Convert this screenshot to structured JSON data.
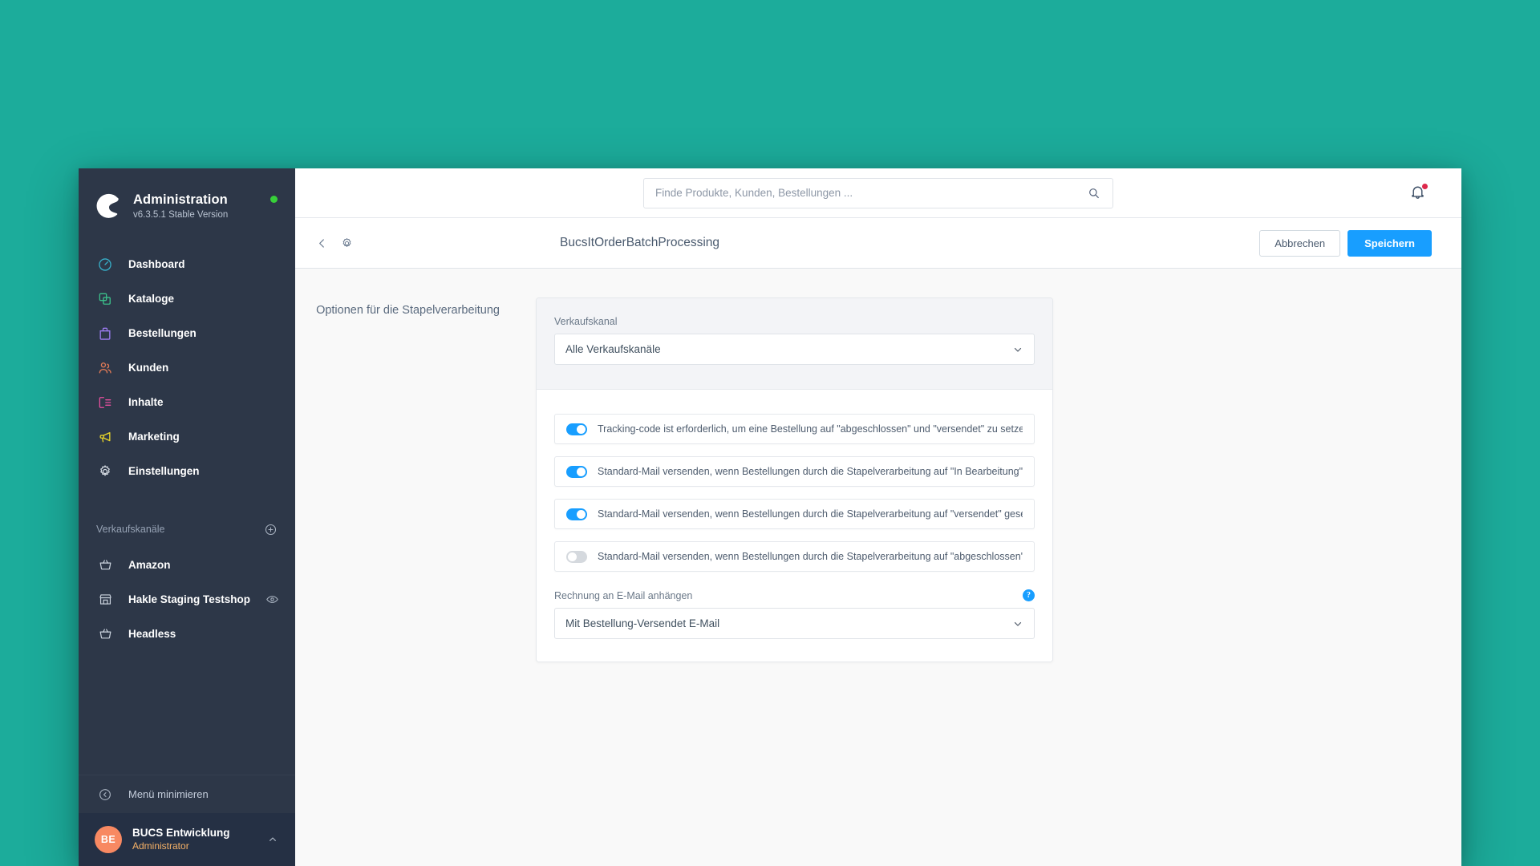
{
  "theme": {
    "desktop_background": "#1cac9b",
    "sidebar_background": "#2d3748",
    "primary_button": "#189eff",
    "avatar_background": "#f88962",
    "status_dot": "#37d039",
    "notification_dot": "#de294c"
  },
  "sidebar": {
    "logo_icon": "shopware-logo-icon",
    "title": "Administration",
    "version": "v6.3.5.1 Stable Version",
    "status_dot_icon": "status-online-dot-icon",
    "nav_items": [
      {
        "label": "Dashboard",
        "icon": "dashboard-icon",
        "color": "#37afc9"
      },
      {
        "label": "Kataloge",
        "icon": "catalog-icon",
        "color": "#3bbf8a"
      },
      {
        "label": "Bestellungen",
        "icon": "orders-bag-icon",
        "color": "#9c7bf0"
      },
      {
        "label": "Kunden",
        "icon": "customers-icon",
        "color": "#e07a56"
      },
      {
        "label": "Inhalte",
        "icon": "content-icon",
        "color": "#e7509e"
      },
      {
        "label": "Marketing",
        "icon": "megaphone-icon",
        "color": "#e8d429"
      },
      {
        "label": "Einstellungen",
        "icon": "gear-icon",
        "color": "#d4dae2"
      }
    ],
    "sales_channel_section": {
      "title": "Verkaufskanäle",
      "add_icon": "plus-circle-icon",
      "items": [
        {
          "label": "Amazon",
          "icon": "basket-icon",
          "has_preview": false
        },
        {
          "label": "Hakle Staging Testshop",
          "icon": "storefront-icon",
          "has_preview": true,
          "preview_icon": "eye-icon"
        },
        {
          "label": "Headless",
          "icon": "basket-icon",
          "has_preview": false
        }
      ]
    },
    "minimize": {
      "label": "Menü minimieren",
      "icon": "chevron-left-circle-icon"
    },
    "user": {
      "initials": "BE",
      "name": "BUCS Entwicklung",
      "role": "Administrator",
      "caret_icon": "chevron-up-icon"
    }
  },
  "topbar": {
    "search": {
      "placeholder": "Finde Produkte, Kunden, Bestellungen ...",
      "value": "",
      "icon": "search-icon"
    },
    "notifications": {
      "icon": "bell-icon",
      "has_unread": true
    }
  },
  "toolbar": {
    "back_icon": "chevron-left-icon",
    "settings_icon": "gear-icon",
    "title": "BucsItOrderBatchProcessing",
    "cancel_label": "Abbrechen",
    "save_label": "Speichern"
  },
  "main": {
    "section_label": "Optionen für die Stapelverarbeitung",
    "sales_channel_field": {
      "label": "Verkaufskanal",
      "value": "Alle Verkaufskanäle",
      "chevron_icon": "chevron-down-icon"
    },
    "toggles": [
      {
        "label": "Tracking-code ist erforderlich, um eine Bestellung auf \"abgeschlossen\" und \"versendet\" zu setzen",
        "on": true
      },
      {
        "label": "Standard-Mail versenden, wenn Bestellungen durch die Stapelverarbeitung auf \"In Bearbeitung\" gesetzt werden.",
        "on": true
      },
      {
        "label": "Standard-Mail versenden, wenn Bestellungen durch die Stapelverarbeitung auf \"versendet\" gesetzt werden.",
        "on": true
      },
      {
        "label": "Standard-Mail versenden, wenn Bestellungen durch die Stapelverarbeitung auf \"abgeschlossen\" gesetzt werden.",
        "on": false
      }
    ],
    "invoice_field": {
      "label": "Rechnung an E-Mail anhängen",
      "value": "Mit Bestellung-Versendet E-Mail",
      "help_icon": "help-circle-icon",
      "help_glyph": "?",
      "chevron_icon": "chevron-down-icon"
    }
  }
}
